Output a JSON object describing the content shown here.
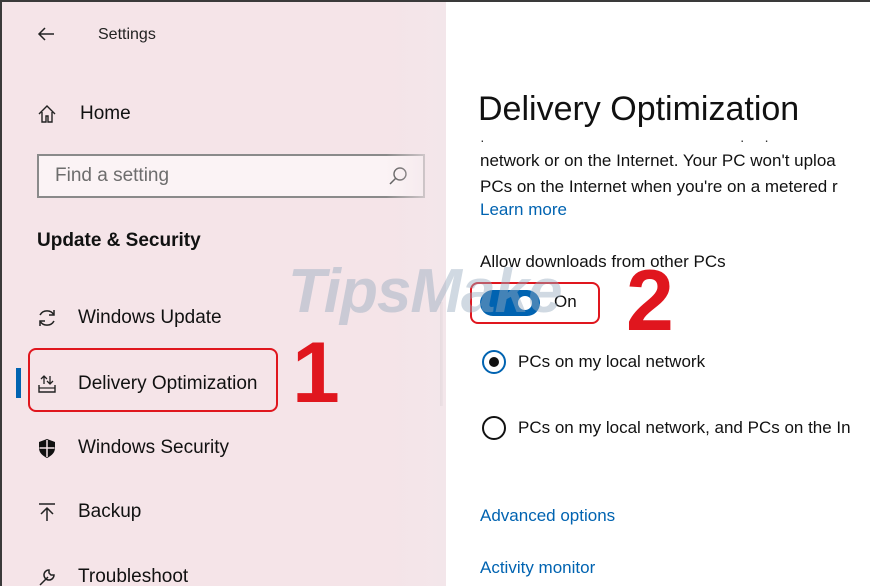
{
  "window": {
    "app_title": "Settings"
  },
  "sidebar": {
    "home_label": "Home",
    "search_placeholder": "Find a setting",
    "section_heading": "Update & Security",
    "items": [
      {
        "label": "Windows Update",
        "icon": "refresh-icon"
      },
      {
        "label": "Delivery Optimization",
        "icon": "delivery-optimization-icon",
        "active": true
      },
      {
        "label": "Windows Security",
        "icon": "shield-icon"
      },
      {
        "label": "Backup",
        "icon": "backup-arrow-icon"
      },
      {
        "label": "Troubleshoot",
        "icon": "wrench-icon"
      }
    ]
  },
  "main": {
    "title": "Delivery Optimization",
    "desc_line1": "network or on the Internet. Your PC won't uploa",
    "desc_line2": "PCs on the Internet when you're on a metered r",
    "learn_more": "Learn more",
    "allow_label": "Allow downloads from other PCs",
    "toggle_state": "On",
    "radio_options": [
      {
        "label": "PCs on my local network",
        "selected": true
      },
      {
        "label": "PCs on my local network, and PCs on the In",
        "selected": false
      }
    ],
    "advanced_options": "Advanced options",
    "activity_monitor": "Activity monitor"
  },
  "annotations": {
    "marker_1": "1",
    "marker_2": "2"
  },
  "watermark": "TipsMake",
  "colors": {
    "accent": "#0063b1",
    "highlight": "#e0161e",
    "sidebar_bg": "#f5e4e8"
  }
}
